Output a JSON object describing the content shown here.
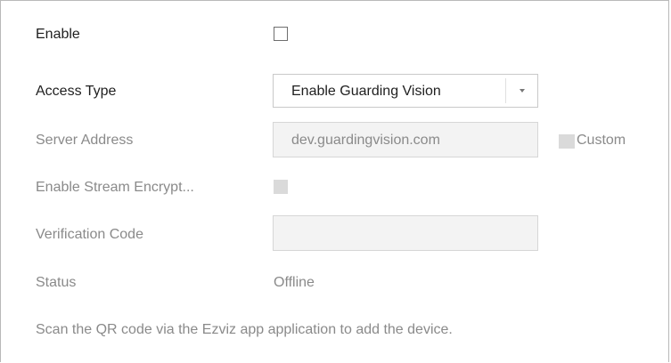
{
  "enable": {
    "label": "Enable",
    "checked": false
  },
  "access_type": {
    "label": "Access Type",
    "selected": "Enable Guarding Vision",
    "caret_icon": "caret-down-icon"
  },
  "server_address": {
    "label": "Server Address",
    "value": "dev.guardingvision.com",
    "custom_label": "Custom",
    "custom_checked": false
  },
  "stream_encryption": {
    "label": "Enable Stream Encrypt...",
    "checked": false
  },
  "verification_code": {
    "label": "Verification Code",
    "value": ""
  },
  "status": {
    "label": "Status",
    "value": "Offline"
  },
  "note": "Scan the QR code via the Ezviz app application to add the device.",
  "colors": {
    "text": "#1f1f1f",
    "disabled_text": "#8a8a8a",
    "disabled_fill": "#dadada",
    "field_fill": "#f3f3f3",
    "border": "#b9b9b9"
  }
}
